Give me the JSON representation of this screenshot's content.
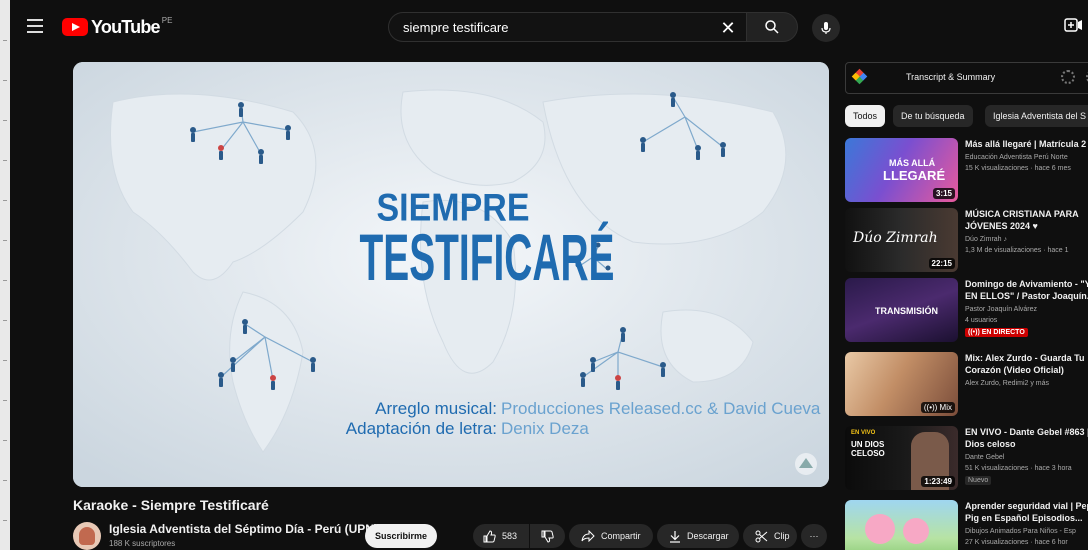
{
  "masthead": {
    "logo_text": "YouTube",
    "region": "PE",
    "search_value": "siempre testificare",
    "search_placeholder": "Buscar"
  },
  "video": {
    "overlay_title_line1": "SIEMPRE",
    "overlay_title_line2": "TESTIFICARÉ",
    "credit1_label": "Arreglo musical:",
    "credit1_value": "Producciones Released.cc & David Cueva",
    "credit2_label": "Adaptación de letra:",
    "credit2_value": "Denix Deza",
    "title": "Karaoke - Siempre Testificaré"
  },
  "channel": {
    "name": "Iglesia Adventista del Séptimo Día - Perú (UPN)",
    "subscribers": "188 K suscriptores",
    "subscribe_label": "Suscribirme"
  },
  "actions": {
    "like_count": "583",
    "share_label": "Compartir",
    "download_label": "Descargar",
    "clip_label": "Clip",
    "more_label": "···"
  },
  "transcript": {
    "label": "Transcript & Summary"
  },
  "chips": [
    "Todos",
    "De tu búsqueda",
    "Iglesia Adventista del S"
  ],
  "recommendations": [
    {
      "title": "Más allá llegaré | Matrícula 2",
      "channel": "Educación Adventista Perú Norte",
      "meta": "15 K visualizaciones · hace 6 mes",
      "duration": "3:15",
      "thumb_text1": "MÁS ALLÁ",
      "thumb_text2": "LLEGARÉ"
    },
    {
      "title": "MÚSICA CRISTIANA PARA JÓVENES 2024 ♥",
      "channel": "Dúo Zimrah ♪",
      "meta": "1,3 M de visualizaciones · hace 1",
      "duration": "22:15",
      "thumb_text1": "Dúo Zimrah"
    },
    {
      "title": "Domingo de Avivamiento - \"Y EN ELLOS\" / Pastor Joaquín...",
      "channel": "Pastor Joaquín Alvárez",
      "meta": "4 usuarios",
      "live": "((•)) EN DIRECTO",
      "thumb_text1": "TRANSMISIÓN"
    },
    {
      "title": "Mix: Alex Zurdo - Guarda Tu Corazón (Video Oficial)",
      "channel": "Alex Zurdo, Redimi2 y más",
      "badge": "((•)) Mix"
    },
    {
      "title": "EN VIVO - Dante Gebel #863 | Dios celoso",
      "channel": "Dante Gebel",
      "meta": "51 K visualizaciones · hace 3 hora",
      "duration": "1:23:49",
      "new_label": "Nuevo",
      "thumb_text1": "EN VIVO",
      "thumb_text2": "UN DIOS CELOSO"
    },
    {
      "title": "Aprender seguridad vial | Pep Pig en Español Episodios...",
      "channel": "Dibujos Animados Para Niños - Esp",
      "meta": "27 K visualizaciones · hace 6 hor"
    }
  ]
}
